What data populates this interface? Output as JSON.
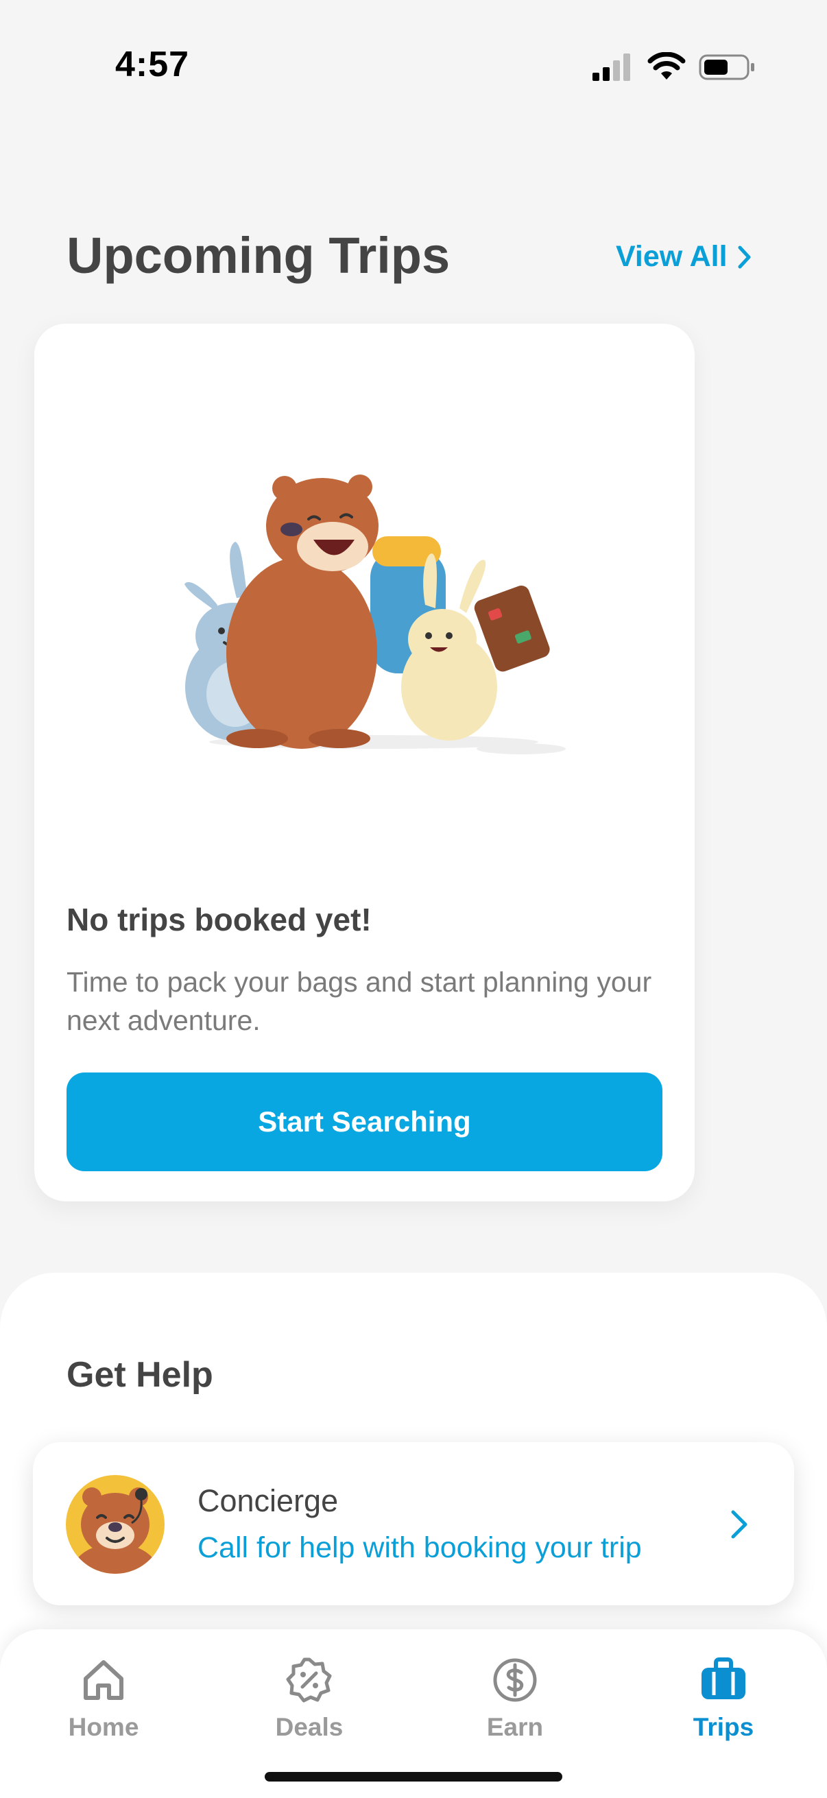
{
  "status_bar": {
    "time": "4:57"
  },
  "header": {
    "title": "Upcoming Trips",
    "view_all_label": "View All"
  },
  "trip_card": {
    "empty_title": "No trips booked yet!",
    "empty_subtitle": "Time to pack your bags and start planning your next adventure.",
    "button_label": "Start Searching"
  },
  "help": {
    "title": "Get Help",
    "concierge": {
      "name": "Concierge",
      "subtitle": "Call for help with booking your trip"
    }
  },
  "tab_bar": {
    "items": [
      {
        "label": "Home",
        "icon": "home-icon",
        "active": false
      },
      {
        "label": "Deals",
        "icon": "badge-percent-icon",
        "active": false
      },
      {
        "label": "Earn",
        "icon": "dollar-circle-icon",
        "active": false
      },
      {
        "label": "Trips",
        "icon": "suitcase-icon",
        "active": true
      }
    ]
  },
  "colors": {
    "accent": "#08a7e1",
    "link": "#0b9fd8",
    "active_tab": "#0b8fd0",
    "background": "#f5f5f5"
  }
}
